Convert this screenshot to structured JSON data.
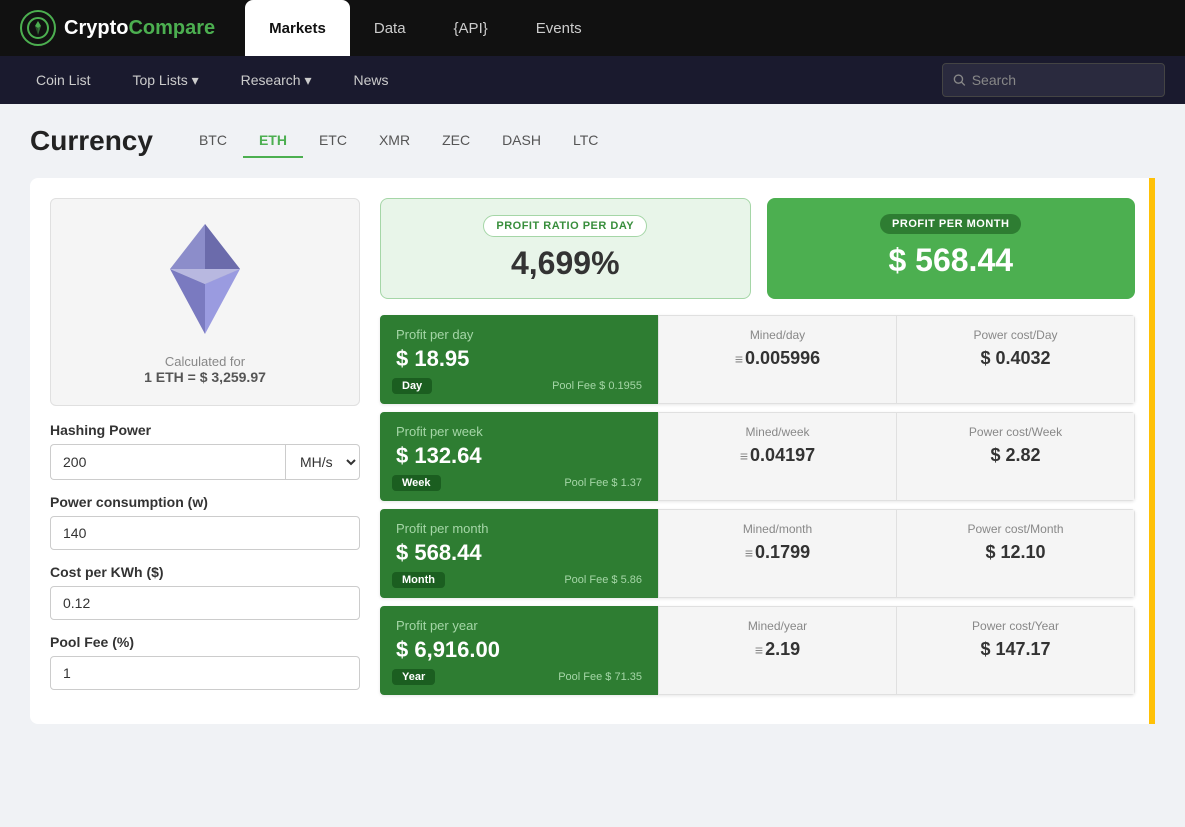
{
  "logo": {
    "crypto": "Crypto",
    "compare": "Compare",
    "icon": "M"
  },
  "main_nav": {
    "items": [
      {
        "label": "Markets",
        "active": true
      },
      {
        "label": "Data"
      },
      {
        "label": "{API}"
      },
      {
        "label": "Events"
      }
    ]
  },
  "sub_nav": {
    "items": [
      {
        "label": "Coin List"
      },
      {
        "label": "Top Lists ▾"
      },
      {
        "label": "Research ▾"
      },
      {
        "label": "News"
      }
    ],
    "search_placeholder": "Search"
  },
  "currency": {
    "title": "Currency",
    "tabs": [
      {
        "label": "BTC"
      },
      {
        "label": "ETH",
        "active": true
      },
      {
        "label": "ETC"
      },
      {
        "label": "XMR"
      },
      {
        "label": "ZEC"
      },
      {
        "label": "DASH"
      },
      {
        "label": "LTC"
      }
    ]
  },
  "calc_for": {
    "label": "Calculated for",
    "value": "1 ETH = $ 3,259.97"
  },
  "form": {
    "hashing_power_label": "Hashing Power",
    "hashing_power_value": "200",
    "hashing_unit": "MH/s",
    "power_consumption_label": "Power consumption (w)",
    "power_consumption_value": "140",
    "cost_per_kwh_label": "Cost per KWh ($)",
    "cost_per_kwh_value": "0.12",
    "pool_fee_label": "Pool Fee (%)",
    "pool_fee_value": "1"
  },
  "summary": {
    "profit_ratio_label": "PROFIT RATIO PER DAY",
    "profit_ratio_value": "4,699%",
    "profit_month_label": "PROFIT PER MONTH",
    "profit_month_value": "$ 568.44"
  },
  "rows": [
    {
      "badge": "Day",
      "profit_label": "Profit per day",
      "profit_value": "$ 18.95",
      "pool_fee": "Pool Fee $ 0.1955",
      "mined_label": "Mined/day",
      "mined_value": "0.005996",
      "power_label": "Power cost/Day",
      "power_value": "$ 0.4032"
    },
    {
      "badge": "Week",
      "profit_label": "Profit per week",
      "profit_value": "$ 132.64",
      "pool_fee": "Pool Fee $ 1.37",
      "mined_label": "Mined/week",
      "mined_value": "0.04197",
      "power_label": "Power cost/Week",
      "power_value": "$ 2.82"
    },
    {
      "badge": "Month",
      "profit_label": "Profit per month",
      "profit_value": "$ 568.44",
      "pool_fee": "Pool Fee $ 5.86",
      "mined_label": "Mined/month",
      "mined_value": "0.1799",
      "power_label": "Power cost/Month",
      "power_value": "$ 12.10"
    },
    {
      "badge": "Year",
      "profit_label": "Profit per year",
      "profit_value": "$ 6,916.00",
      "pool_fee": "Pool Fee $ 71.35",
      "mined_label": "Mined/year",
      "mined_value": "2.19",
      "power_label": "Power cost/Year",
      "power_value": "$ 147.17"
    }
  ]
}
